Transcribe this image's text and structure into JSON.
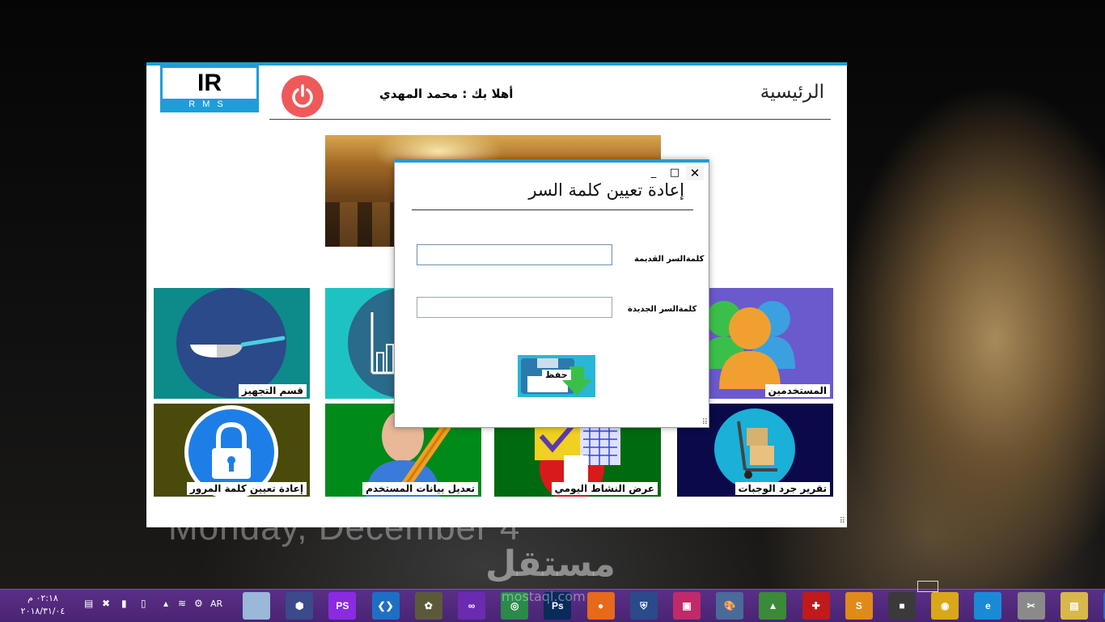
{
  "desktop": {
    "date_text": "Monday, December 4",
    "watermark_logo": "مستقل",
    "watermark_url": "mostaql.com"
  },
  "main_window": {
    "logo_text": "IR",
    "logo_sub": "RMS",
    "welcome_text": "أهلا بك : محمد المهدي",
    "page_title": "الرئيسية",
    "tiles": [
      {
        "label": "قسم التجهيز",
        "icon": "frying-pan-icon",
        "color": "#0d8a8a"
      },
      {
        "label": "",
        "icon": "bar-chart-icon",
        "color": "#1fc2c2"
      },
      {
        "label": "المستخدمين",
        "icon": "users-icon",
        "color": "#6a5acd"
      },
      {
        "label": "إعادة تعيين كلمة المرور",
        "icon": "lock-icon",
        "color": "#4a4a0a"
      },
      {
        "label": "تعديل بيانات المستخدم",
        "icon": "user-edit-icon",
        "color": "#008a1a"
      },
      {
        "label": "عرض النشاط اليومي",
        "icon": "checklist-icon",
        "color": "#006a10"
      },
      {
        "label": "تقرير جرد الوجبات",
        "icon": "hand-truck-icon",
        "color": "#0a0a4a"
      }
    ]
  },
  "dialog": {
    "title": "إعادة تعيين كلمة السر",
    "min_symbol": "_",
    "max_symbol": "□",
    "close_symbol": "✕",
    "old_password_label": "كلمةالسر القديمة",
    "new_password_label": "كلمةالسر الجديدة",
    "old_password_value": "",
    "new_password_value": "",
    "save_label": "حفظ"
  },
  "taskbar": {
    "time": "٠٢:١٨ م",
    "date": "٢٠١٨/٣١/٠٤",
    "lang": "AR",
    "apps": [
      {
        "name": "window-app-icon",
        "text": "",
        "color": "#9ab8d8"
      },
      {
        "name": "virtualbox-icon",
        "text": "⬢",
        "color": "#3a4a8a"
      },
      {
        "name": "phpstorm-icon",
        "text": "PS",
        "color": "#8a2be2"
      },
      {
        "name": "vscode-icon",
        "text": "❮❯",
        "color": "#1e6fc4"
      },
      {
        "name": "gimp-icon",
        "text": "✿",
        "color": "#5a5a3a"
      },
      {
        "name": "visual-studio-icon",
        "text": "∞",
        "color": "#6a2bb0"
      },
      {
        "name": "globe-app-icon",
        "text": "◎",
        "color": "#2a8a4a"
      },
      {
        "name": "photoshop-icon",
        "text": "Ps",
        "color": "#0a2a5a"
      },
      {
        "name": "firefox-icon",
        "text": "●",
        "color": "#e66a1a"
      },
      {
        "name": "shield-app-icon",
        "text": "⛨",
        "color": "#2a4a8a"
      },
      {
        "name": "app-square-icon",
        "text": "▣",
        "color": "#c02a6a"
      },
      {
        "name": "paint-icon",
        "text": "🎨",
        "color": "#4a6a9a"
      },
      {
        "name": "android-studio-icon",
        "text": "▲",
        "color": "#3a8a3a"
      },
      {
        "name": "antivirus-icon",
        "text": "✚",
        "color": "#c01a1a"
      },
      {
        "name": "sublime-icon",
        "text": "S",
        "color": "#e08a1a"
      },
      {
        "name": "camera-app-icon",
        "text": "■",
        "color": "#3a3a3a"
      },
      {
        "name": "chrome-icon",
        "text": "◉",
        "color": "#d8a81a"
      },
      {
        "name": "ie-icon",
        "text": "e",
        "color": "#1a8ad8"
      },
      {
        "name": "tools-icon",
        "text": "✂",
        "color": "#8a8a8a"
      },
      {
        "name": "file-explorer-icon",
        "text": "▤",
        "color": "#d8b84a"
      },
      {
        "name": "start-icon",
        "text": "⊞",
        "color": "#2a6ac8"
      }
    ]
  }
}
